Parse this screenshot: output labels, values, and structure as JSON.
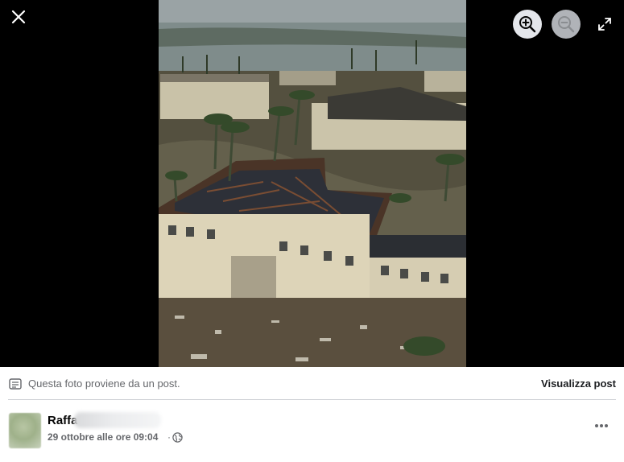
{
  "viewer": {
    "close_icon": "close-icon",
    "zoom_in_icon": "zoom-in-icon",
    "zoom_out_icon": "zoom-out-icon",
    "fullscreen_icon": "fullscreen-icon",
    "photo_subject": "aerial view of storm-damaged buildings with palm trees and flooding"
  },
  "info_bar": {
    "icon": "post-icon",
    "text": "Questa foto proviene da un post.",
    "view_post_label": "Visualizza post"
  },
  "author": {
    "name": "Raffa",
    "date": "29 ottobre alle ore 09:04",
    "separator": "·",
    "privacy_icon": "globe-icon",
    "more_icon": "more-options-icon"
  },
  "colors": {
    "viewer_background": "#000000",
    "zoom_in_background": "#e4e6eb",
    "zoom_out_background": "#b0b3b8",
    "secondary_text": "#65676b",
    "primary_text": "#050505"
  }
}
